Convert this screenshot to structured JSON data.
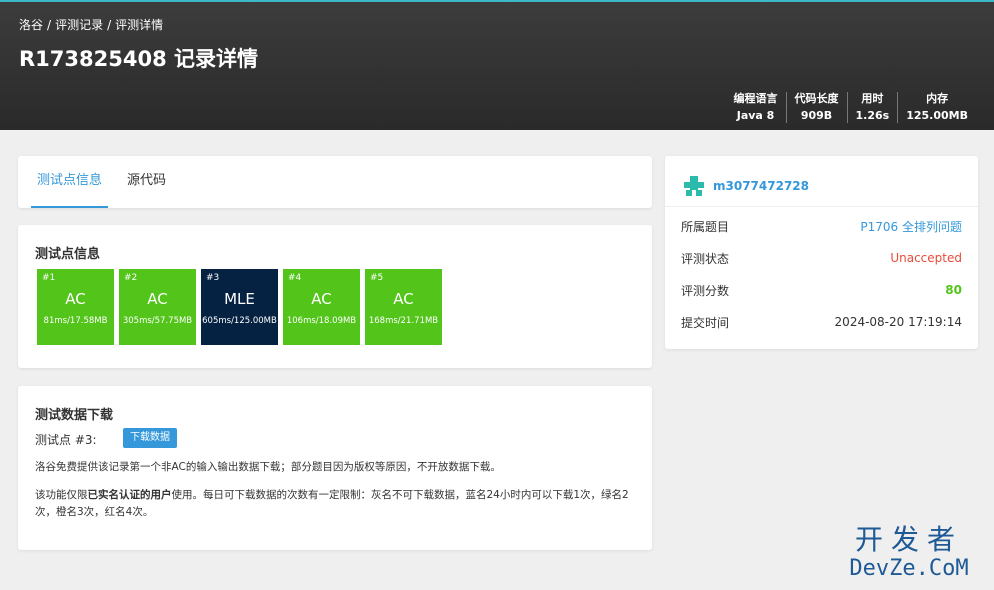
{
  "breadcrumb": {
    "items": [
      "洛谷",
      "评测记录",
      "评测详情"
    ],
    "separator": "/"
  },
  "page": {
    "title": "R173825408 记录详情"
  },
  "stats": [
    {
      "label": "编程语言",
      "value": "Java 8"
    },
    {
      "label": "代码长度",
      "value": "909B"
    },
    {
      "label": "用时",
      "value": "1.26s"
    },
    {
      "label": "内存",
      "value": "125.00MB"
    }
  ],
  "tabs": [
    {
      "label": "测试点信息",
      "active": true
    },
    {
      "label": "源代码",
      "active": false
    }
  ],
  "testcases": {
    "title": "测试点信息",
    "items": [
      {
        "num": "#1",
        "status": "AC",
        "time_mem": "81ms/17.58MB",
        "color": "#52c41a"
      },
      {
        "num": "#2",
        "status": "AC",
        "time_mem": "305ms/57.75MB",
        "color": "#52c41a"
      },
      {
        "num": "#3",
        "status": "MLE",
        "time_mem": "605ms/125.00MB",
        "color": "#052242"
      },
      {
        "num": "#4",
        "status": "AC",
        "time_mem": "106ms/18.09MB",
        "color": "#52c41a"
      },
      {
        "num": "#5",
        "status": "AC",
        "time_mem": "168ms/21.71MB",
        "color": "#52c41a"
      }
    ]
  },
  "download": {
    "title": "测试数据下载",
    "point_label": "测试点 #3:",
    "button_label": "下载数据",
    "note1": "洛谷免费提供该记录第一个非AC的输入输出数据下载；部分题目因为版权等原因，不开放数据下载。",
    "note2_prefix": "该功能仅限",
    "note2_bold": "已实名认证的用户",
    "note2_suffix": "使用。每日可下载数据的次数有一定限制：灰名不可下载数据，蓝名24小时内可以下载1次，绿名2次，橙名3次，红名4次。"
  },
  "sidebar": {
    "username": "m3077472728",
    "rows": [
      {
        "key": "所属题目",
        "value": "P1706 全排列问题"
      },
      {
        "key": "评测状态",
        "value": "Unaccepted"
      },
      {
        "key": "评测分数",
        "value": "80"
      },
      {
        "key": "提交时间",
        "value": "2024-08-20 17:19:14"
      }
    ]
  },
  "watermark": {
    "line1": "开发者",
    "line2": "DevZe.CoM"
  },
  "colors": {
    "accent": "#3498db",
    "ac": "#52c41a",
    "mle": "#052242",
    "unaccepted": "#e74c3c",
    "score": "#52c41a",
    "header": "#333333"
  }
}
